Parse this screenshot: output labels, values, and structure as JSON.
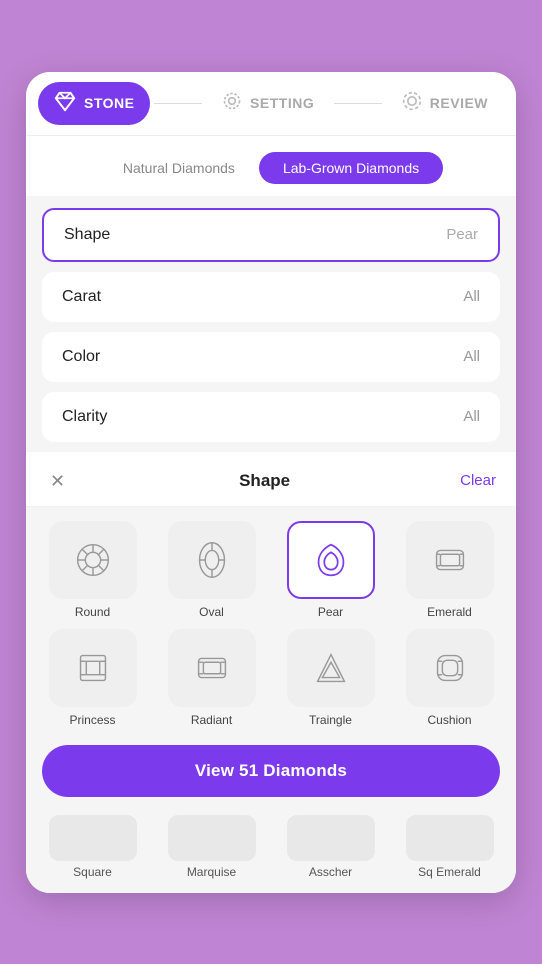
{
  "nav": {
    "steps": [
      {
        "id": "stone",
        "label": "STONE",
        "icon": "💎",
        "active": true
      },
      {
        "id": "setting",
        "label": "SETTING",
        "icon": "💍",
        "active": false
      },
      {
        "id": "review",
        "label": "REVIEW",
        "icon": "👁",
        "active": false
      }
    ]
  },
  "diamond_tabs": {
    "options": [
      {
        "id": "natural",
        "label": "Natural Diamonds",
        "active": false
      },
      {
        "id": "lab",
        "label": "Lab-Grown Diamonds",
        "active": true
      }
    ]
  },
  "filters": [
    {
      "id": "shape",
      "label": "Shape",
      "value": "Pear",
      "active": true
    },
    {
      "id": "carat",
      "label": "Carat",
      "value": "All",
      "active": false
    },
    {
      "id": "color",
      "label": "Color",
      "value": "All",
      "active": false
    },
    {
      "id": "clarity",
      "label": "Clarity",
      "value": "All",
      "active": false
    }
  ],
  "shape_modal": {
    "title": "Shape",
    "clear_label": "Clear",
    "shapes": [
      {
        "id": "round",
        "label": "Round",
        "selected": false
      },
      {
        "id": "oval",
        "label": "Oval",
        "selected": false
      },
      {
        "id": "pear",
        "label": "Pear",
        "selected": true
      },
      {
        "id": "emerald",
        "label": "Emerald",
        "selected": false
      },
      {
        "id": "princess",
        "label": "Princess",
        "selected": false
      },
      {
        "id": "radiant",
        "label": "Radiant",
        "selected": false
      },
      {
        "id": "traingle",
        "label": "Traingle",
        "selected": false
      },
      {
        "id": "cushion",
        "label": "Cushion",
        "selected": false
      }
    ],
    "bottom_shapes": [
      {
        "id": "square",
        "label": "Square"
      },
      {
        "id": "marquise",
        "label": "Marquise"
      },
      {
        "id": "asscher",
        "label": "Asscher"
      },
      {
        "id": "sq_emerald",
        "label": "Sq Emerald"
      }
    ],
    "cta_label": "View 51 Diamonds"
  }
}
